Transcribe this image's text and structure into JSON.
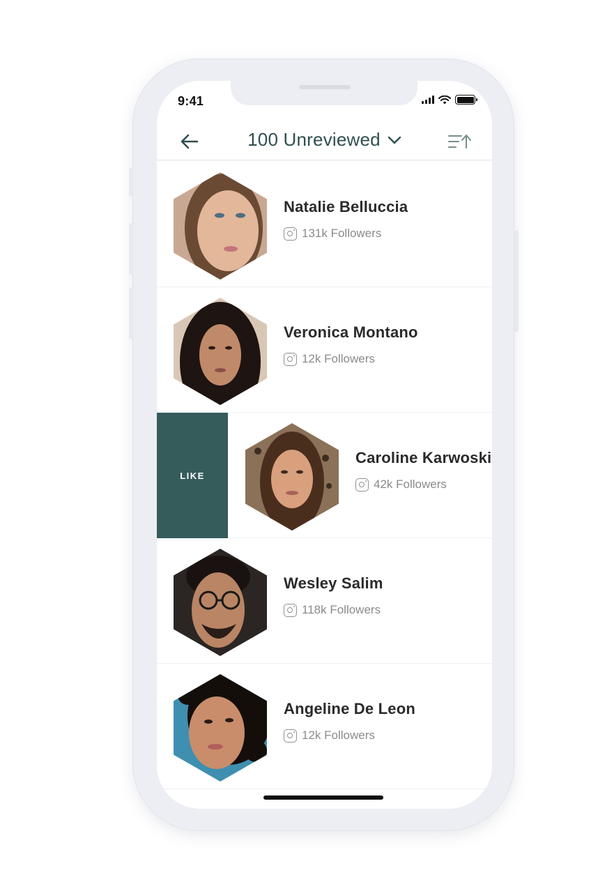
{
  "status_bar": {
    "time": "9:41"
  },
  "header": {
    "title": "100 Unreviewed",
    "back_icon": "arrow-left-icon",
    "sort_icon": "sort-ascending-icon"
  },
  "swipe_action": {
    "label": "LIKE",
    "color": "#365b5b"
  },
  "profiles": [
    {
      "name": "Natalie Belluccia",
      "followers": "131k Followers",
      "palette": {
        "bg": "#c9a893",
        "skin": "#e2b79a",
        "hair": "#6b4a34"
      }
    },
    {
      "name": "Veronica Montano",
      "followers": "12k Followers",
      "palette": {
        "bg": "#d9c7b6",
        "skin": "#c08a6a",
        "hair": "#1e1411"
      }
    },
    {
      "name": "Caroline Karwoski",
      "followers": "42k Followers",
      "palette": {
        "bg": "#8a7158",
        "skin": "#d9a07e",
        "hair": "#4a2e1d"
      }
    },
    {
      "name": "Wesley Salim",
      "followers": "118k Followers",
      "palette": {
        "bg": "#2b2623",
        "skin": "#b98565",
        "hair": "#1a1210"
      }
    },
    {
      "name": "Angeline De Leon",
      "followers": "12k Followers",
      "palette": {
        "bg": "#3f8fb0",
        "skin": "#c98d6b",
        "hair": "#140e0b"
      }
    }
  ]
}
